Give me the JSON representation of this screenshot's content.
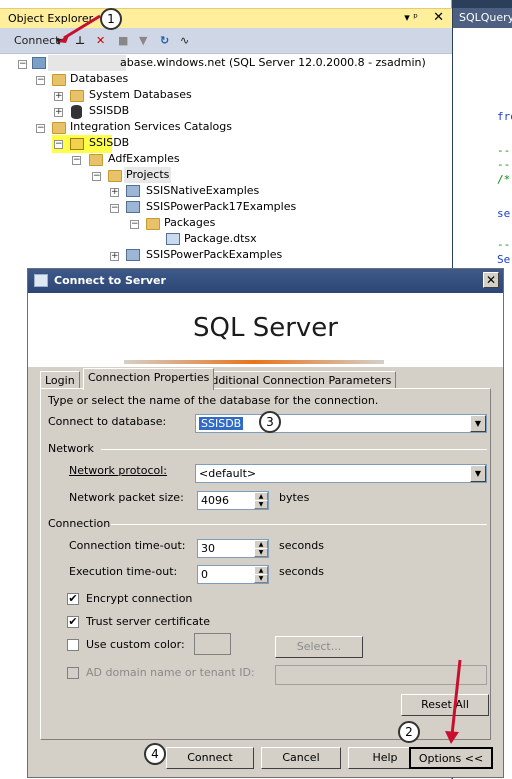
{
  "object_explorer": {
    "title": "Object Explorer",
    "pin": "▾ ᵖ",
    "close": "✕",
    "toolbar_connect": "Connect",
    "tree": [
      {
        "label": "abase.windows.net (SQL Server 12.0.2000.8 - zsadmin)"
      },
      {
        "label": "Databases"
      },
      {
        "label": "System Databases"
      },
      {
        "label": "SSISDB"
      },
      {
        "label": "Integration Services Catalogs"
      },
      {
        "label": "SSISDB"
      },
      {
        "label": "AdfExamples"
      },
      {
        "label": "Projects"
      },
      {
        "label": "SSISNativeExamples"
      },
      {
        "label": "SSISPowerPack17Examples"
      },
      {
        "label": "Packages"
      },
      {
        "label": "Package.dtsx"
      },
      {
        "label": "SSISPowerPackExamples"
      }
    ]
  },
  "query_editor": {
    "tab_title": "SQLQuery",
    "code_lines": [
      "fro",
      "--",
      "--",
      "/*",
      "se",
      "--",
      "Se"
    ]
  },
  "dialog": {
    "title": "Connect to Server",
    "banner": "SQL Server",
    "tabs": [
      "Login",
      "Connection Properties",
      "Additional Connection Parameters"
    ],
    "instruction": "Type or select the name of the database for the connection.",
    "connect_to_db_label": "Connect to database:",
    "connect_to_db_value": "SSISDB",
    "network_group": "Network",
    "protocol_label": "Network protocol:",
    "protocol_value": "<default>",
    "packet_label": "Network packet size:",
    "packet_value": "4096",
    "packet_unit": "bytes",
    "connection_group": "Connection",
    "conn_timeout_label": "Connection time-out:",
    "conn_timeout_value": "30",
    "exec_timeout_label": "Execution time-out:",
    "exec_timeout_value": "0",
    "seconds": "seconds",
    "encrypt_label": "Encrypt connection",
    "encrypt_checked": "✔",
    "trust_label": "Trust server certificate",
    "trust_checked": "✔",
    "custom_color_label": "Use custom color:",
    "select_btn": "Select...",
    "ad_label": "AD domain name or tenant ID:",
    "reset_btn": "Reset All",
    "connect_btn": "Connect",
    "cancel_btn": "Cancel",
    "help_btn": "Help",
    "options_btn": "Options <<"
  },
  "callouts": [
    "1",
    "2",
    "3",
    "4"
  ]
}
